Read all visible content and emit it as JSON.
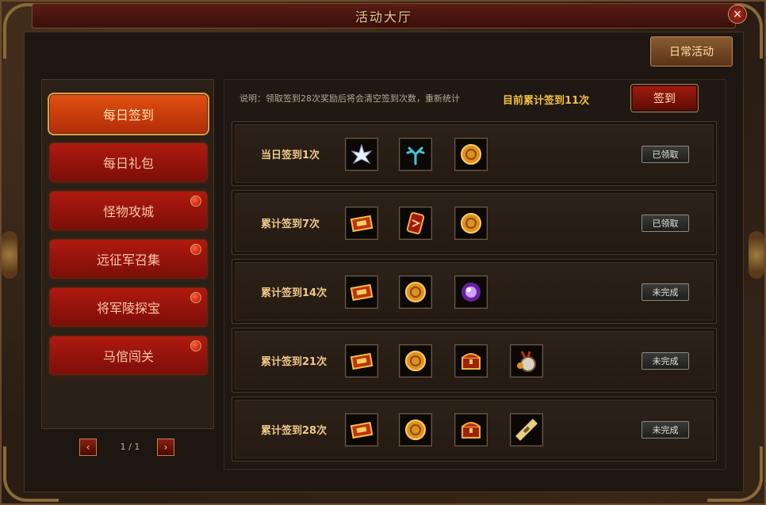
{
  "window": {
    "title": "活动大厅",
    "close": "×"
  },
  "daily_button": "日常活动",
  "sidebar": {
    "tabs": [
      {
        "label": "每日签到",
        "active": true,
        "dot": false
      },
      {
        "label": "每日礼包",
        "active": false,
        "dot": false
      },
      {
        "label": "怪物攻城",
        "active": false,
        "dot": true
      },
      {
        "label": "远征军召集",
        "active": false,
        "dot": true
      },
      {
        "label": "将军陵探宝",
        "active": false,
        "dot": true
      },
      {
        "label": "马倌闯关",
        "active": false,
        "dot": true
      }
    ],
    "pager": {
      "prev": "‹",
      "next": "›",
      "text": "1 / 1"
    }
  },
  "main": {
    "note": "说明：领取签到28次奖励后将会清空签到次数，重新统计",
    "total": "目前累计签到11次",
    "signin_button": "签到",
    "rows": [
      {
        "label": "当日签到1次",
        "items": [
          "lotus-icon",
          "coral-icon",
          "gold-coin-icon"
        ],
        "status": "已领取"
      },
      {
        "label": "累计签到7次",
        "items": [
          "voucher-icon",
          "talisman-icon",
          "gold-coin-icon"
        ],
        "status": "已领取"
      },
      {
        "label": "累计签到14次",
        "items": [
          "voucher-icon",
          "gold-coin-icon",
          "purple-orb-icon"
        ],
        "status": "未完成"
      },
      {
        "label": "累计签到21次",
        "items": [
          "voucher-icon",
          "gold-coin-icon",
          "treasure-chest-icon",
          "money-bag-icon"
        ],
        "status": "未完成"
      },
      {
        "label": "累计签到28次",
        "items": [
          "voucher-icon",
          "gold-coin-icon",
          "treasure-chest-icon",
          "scroll-bundle-icon"
        ],
        "status": "未完成"
      }
    ]
  }
}
